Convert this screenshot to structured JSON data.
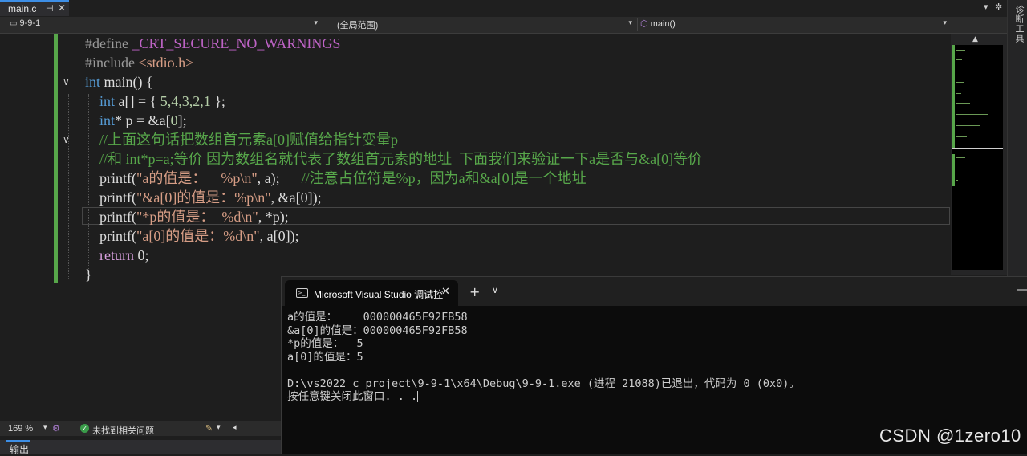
{
  "tabs": {
    "active_label": "main.c",
    "pin_icon": "pin-icon",
    "close_icon": "close-icon"
  },
  "side_panel": {
    "label": "诊断工具"
  },
  "navbar": {
    "project": "9-9-1",
    "scope": "(全局范围)",
    "member": "main()"
  },
  "code": {
    "line1_directive": "#define",
    "line1_macro": "_CRT_SECURE_NO_WARNINGS",
    "line2_directive": "#include",
    "line2_header": "<stdio.h>",
    "line3_type": "int",
    "line3_name": "main() {",
    "line4_type": "int",
    "line4_decl": "a[] = { ",
    "line4_values": "5,4,3,2,1",
    "line4_end": " };",
    "line5_type": "int",
    "line5_rest": "* p = &a[",
    "line5_idx": "0",
    "line5_end": "];",
    "line6_comment": "//上面这句话把数组首元素a[0]赋值给指针变量p",
    "line7_comment": "//和 int*p=a;等价 因为数组名就代表了数组首元素的地址  下面我们来验证一下a是否与&a[0]等价",
    "line8_fn": "printf(",
    "line8_str": "\"a的值是：    %p\\n\"",
    "line8_args": ", a);      ",
    "line8_comment": "//注意占位符是%p，因为a和&a[0]是一个地址",
    "line9_fn": "printf(",
    "line9_str": "\"&a[0]的值是：%p\\n\"",
    "line9_args": ", &a[0]);",
    "line10_fn": "printf(",
    "line10_str": "\"*p的值是：  %d\\n\"",
    "line10_args": ", *p);",
    "line11_fn": "printf(",
    "line11_str": "\"a[0]的值是：%d\\n\"",
    "line11_args": ", a[0]);",
    "line12_kw": "return",
    "line12_val": " 0;",
    "line13": "}"
  },
  "statusbar": {
    "zoom": "169 %",
    "issues": "未找到相关问题"
  },
  "output_panel": {
    "label": "输出"
  },
  "terminal": {
    "tab_label": "Microsoft Visual Studio 调试控",
    "lines": [
      "a的值是：    000000465F92FB58",
      "&a[0]的值是：000000465F92FB58",
      "*p的值是：  5",
      "a[0]的值是：5",
      "",
      "D:\\vs2022 c project\\9-9-1\\x64\\Debug\\9-9-1.exe (进程 21088)已退出，代码为 0 (0x0)。",
      "按任意键关闭此窗口. . ."
    ]
  },
  "watermark": "CSDN @1zero10",
  "colors": {
    "accent": "#3d8ee6",
    "change_bar": "#57a64a",
    "keyword": "#569cd6",
    "string": "#d69d85",
    "comment": "#57a64a"
  }
}
